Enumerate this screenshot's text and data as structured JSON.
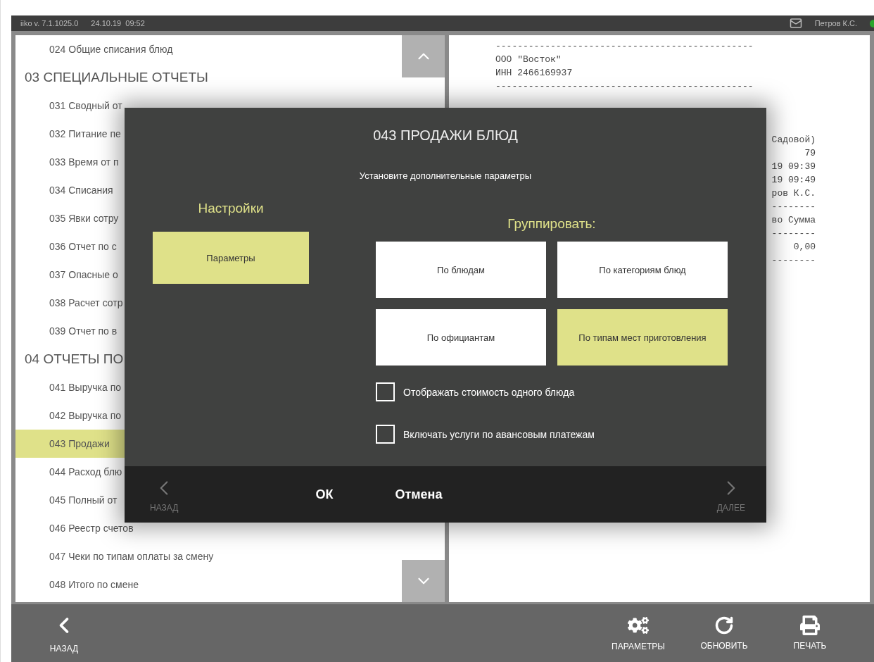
{
  "header": {
    "version": "iiko  v. 7.1.1025.0",
    "date": "24.10.19",
    "time": "09:52",
    "user": "Петров К.С."
  },
  "report_list": [
    {
      "kind": "report",
      "label": "024 Общие списания блюд",
      "selected": false
    },
    {
      "kind": "group",
      "label": "03 СПЕЦИАЛЬНЫЕ ОТЧЕТЫ",
      "selected": false
    },
    {
      "kind": "report",
      "label": "031 Сводный от",
      "selected": false
    },
    {
      "kind": "report",
      "label": "032 Питание пе",
      "selected": false
    },
    {
      "kind": "report",
      "label": "033 Время от п",
      "selected": false
    },
    {
      "kind": "report",
      "label": "034 Списания",
      "selected": false
    },
    {
      "kind": "report",
      "label": "035 Явки сотру",
      "selected": false
    },
    {
      "kind": "report",
      "label": "036 Отчет по с",
      "selected": false
    },
    {
      "kind": "report",
      "label": "037 Опасные о",
      "selected": false
    },
    {
      "kind": "report",
      "label": "038 Расчет сотр",
      "selected": false
    },
    {
      "kind": "report",
      "label": "039 Отчет по в",
      "selected": false
    },
    {
      "kind": "group",
      "label": "04 ОТЧЕТЫ ПО",
      "selected": false
    },
    {
      "kind": "report",
      "label": "041 Выручка по",
      "selected": false
    },
    {
      "kind": "report",
      "label": "042 Выручка по",
      "selected": false
    },
    {
      "kind": "report",
      "label": "043 Продажи",
      "selected": true
    },
    {
      "kind": "report",
      "label": "044 Расход блю",
      "selected": false
    },
    {
      "kind": "report",
      "label": "045 Полный от",
      "selected": false
    },
    {
      "kind": "report",
      "label": "046 Реестр счетов",
      "selected": false
    },
    {
      "kind": "report",
      "label": "047 Чеки по типам оплаты за смену",
      "selected": false
    },
    {
      "kind": "report",
      "label": "048 Итого по смене",
      "selected": false
    }
  ],
  "receipt": {
    "header_lines": [
      "-----------------------------------------------",
      "ООО \"Восток\"",
      "ИНН 2466169937",
      "-----------------------------------------------"
    ],
    "body_lines": [
      "Садовой)",
      "79",
      "19 09:39",
      "19 09:49",
      "ров К.С.",
      "--------",
      "во Сумма",
      "--------",
      "0,00",
      "--------"
    ]
  },
  "dialog": {
    "title": "043 ПРОДАЖИ БЛЮД",
    "subtitle": "Установите дополнительные параметры",
    "settings_title": "Настройки",
    "tabs": [
      {
        "label": "Параметры",
        "selected": true
      }
    ],
    "group_title": "Группировать:",
    "group_options": [
      {
        "label": "По блюдам",
        "selected": false
      },
      {
        "label": "По категориям блюд",
        "selected": false
      },
      {
        "label": "По официантам",
        "selected": false
      },
      {
        "label": "По типам мест приготовления",
        "selected": true
      }
    ],
    "checkboxes": [
      {
        "label": "Отображать стоимость одного блюда",
        "checked": false
      },
      {
        "label": "Включать услуги по авансовым платежам",
        "checked": false
      }
    ],
    "back": "НАЗАД",
    "ok": "ОК",
    "cancel": "Отмена",
    "next": "ДАЛЕЕ"
  },
  "toolbar": {
    "back": "НАЗАД",
    "actions": [
      {
        "kind": "settings",
        "label": "ПАРАМЕТРЫ"
      },
      {
        "kind": "refresh",
        "label": "ОБНОВИТЬ"
      },
      {
        "kind": "print",
        "label": "ПЕЧАТЬ"
      }
    ]
  }
}
